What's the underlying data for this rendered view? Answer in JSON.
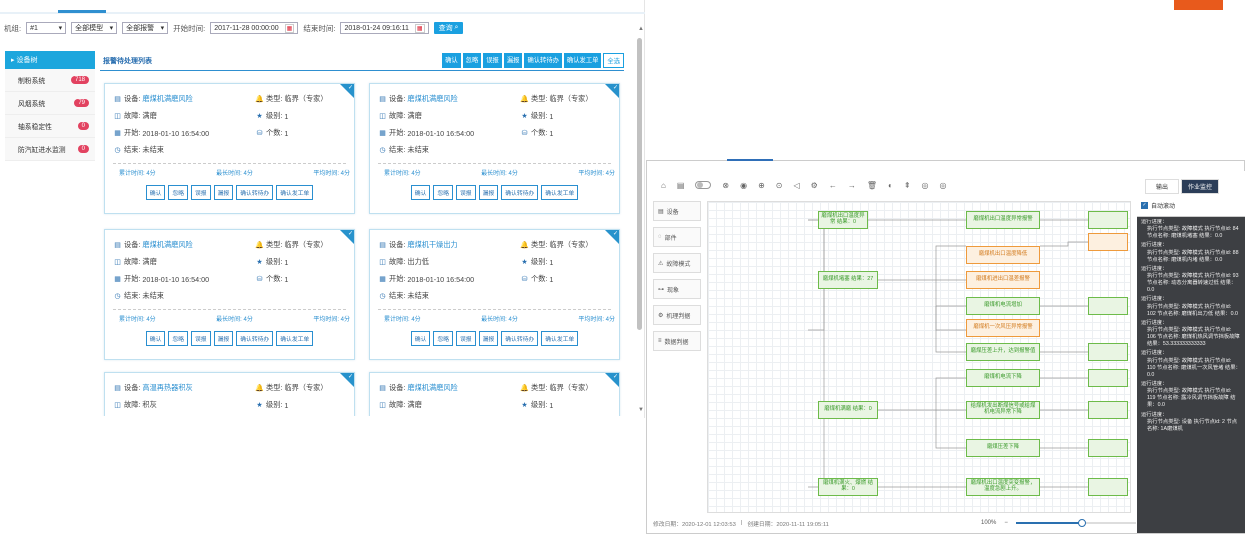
{
  "filter": {
    "group_label": "机组:",
    "group_value": "#1",
    "model_value": "全部模型",
    "alarm_value": "全部报警",
    "start_label": "开始时间:",
    "start_value": "2017-11-28 00:00:00",
    "end_label": "结束时间:",
    "end_value": "2018-01-24 09:16:11",
    "query_label": "查询"
  },
  "sidebar": {
    "title": "设备树",
    "items": [
      {
        "label": "制粉系统",
        "count": "718"
      },
      {
        "label": "风烟系统",
        "count": "79"
      },
      {
        "label": "轴系稳定性",
        "count": "0"
      },
      {
        "label": "防汽缸进水监测",
        "count": "0"
      }
    ]
  },
  "main": {
    "title": "报警待处理列表",
    "actions": [
      "确认",
      "忽略",
      "误报",
      "漏报",
      "确认转待办",
      "确认发工单",
      "全选"
    ]
  },
  "card_labels": {
    "device": "设备:",
    "type": "类型:",
    "fault": "故障:",
    "level": "级别:",
    "start": "开始:",
    "count": "个数:",
    "end": "结束:",
    "stat1": "累计时间:",
    "stat2": "最长时间:",
    "stat3": "平均时间:",
    "btns": [
      "确认",
      "忽略",
      "误报",
      "漏报",
      "确认转待办",
      "确认发工单"
    ]
  },
  "cards": [
    {
      "device": "磨煤机满磨风险",
      "type": "临界（专家）",
      "fault": "满磨",
      "level": "1",
      "start": "2018-01-10 16:54:00",
      "count": "1",
      "end": "未结束",
      "s1": "4分",
      "s2": "4分",
      "s3": "4分"
    },
    {
      "device": "磨煤机满磨风险",
      "type": "临界（专家）",
      "fault": "满磨",
      "level": "1",
      "start": "2018-01-10 16:54:00",
      "count": "1",
      "end": "未结束",
      "s1": "4分",
      "s2": "4分",
      "s3": "4分"
    },
    {
      "device": "磨煤机满磨风险",
      "type": "临界（专家）",
      "fault": "满磨",
      "level": "1",
      "start": "2018-01-10 16:54:00",
      "count": "1",
      "end": "未结束",
      "s1": "4分",
      "s2": "4分",
      "s3": "4分"
    },
    {
      "device": "磨煤机干燥出力",
      "type": "临界（专家）",
      "fault": "出力低",
      "level": "1",
      "start": "2018-01-10 16:54:00",
      "count": "1",
      "end": "未结束",
      "s1": "4分",
      "s2": "4分",
      "s3": "4分"
    },
    {
      "device": "高温再热器积灰",
      "type": "临界（专家）",
      "fault": "积灰",
      "level": "1",
      "start": "",
      "count": "",
      "end": "",
      "s1": "",
      "s2": "",
      "s3": ""
    },
    {
      "device": "磨煤机满磨风险",
      "type": "临界（专家）",
      "fault": "满磨",
      "level": "1",
      "start": "",
      "count": "",
      "end": "",
      "s1": "",
      "s2": "",
      "s3": ""
    }
  ],
  "right": {
    "side_items": [
      "设备",
      "部件",
      "故障模式",
      "现象",
      "机理判据",
      "数据判据"
    ],
    "nodes": [
      "磨煤机出口温度异常 结果：0",
      "磨煤机出口温度异常报警",
      "磨煤机出口温度降低",
      "磨煤机进出口温差报警",
      "磨煤机堵塞 结果：27",
      "磨煤机电流增加",
      "磨煤机一次风压异常报警",
      "磨煤压差上升，达到报警值",
      "磨煤机电流下降",
      "给煤机发出断煤信号或给煤机电流异常下降",
      "磨煤机满磨 结果：0",
      "磨煤压差下降",
      "磨煤机满火、爆燃 结果：0",
      "磨煤机出口温度突变报警，温度急剧上升。"
    ],
    "status_modified": "修改日期：2020-12-01 12:03:53",
    "status_created": "创建日期：2020-11-11 19:05:11",
    "zoom": "100%",
    "zoom_level": 0.55,
    "tab1": "输出",
    "tab2": "作业监控",
    "auto_scroll": "自动滚动",
    "logs": [
      [
        "运行进度：",
        "执行节点类型: 故障模式 执行节点id: 84 节点名称: 磨煤机堵塞 结果：0.0"
      ],
      [
        "运行进度：",
        "执行节点类型: 故障模式 执行节点id: 88 节点名称: 磨煤机内堵 结果：0.0"
      ],
      [
        "运行进度：",
        "执行节点类型: 故障模式 执行节点id: 93 节点名称: 动态分离器转速过低 结果：0.0"
      ],
      [
        "运行进度：",
        "执行节点类型: 故障模式 执行节点id: 102 节点名称: 磨煤机出力低 结果：0.0"
      ],
      [
        "运行进度：",
        "执行节点类型: 故障模式 执行节点id: 106 节点名称: 磨煤机热风调节挡板故障 结果：53.333333333333"
      ],
      [
        "运行进度：",
        "执行节点类型: 故障模式 执行节点id: 110 节点名称: 磨煤机一次风管堵 结果：0.0"
      ],
      [
        "运行进度：",
        "执行节点类型: 故障模式 执行节点id: 119 节点名称: 露冷风调节挡板故障 结果：0.0"
      ],
      [
        "运行进度：",
        "执行节点类型: 设备 执行节点id: 2 节点名称: 1A磨煤机"
      ]
    ]
  }
}
